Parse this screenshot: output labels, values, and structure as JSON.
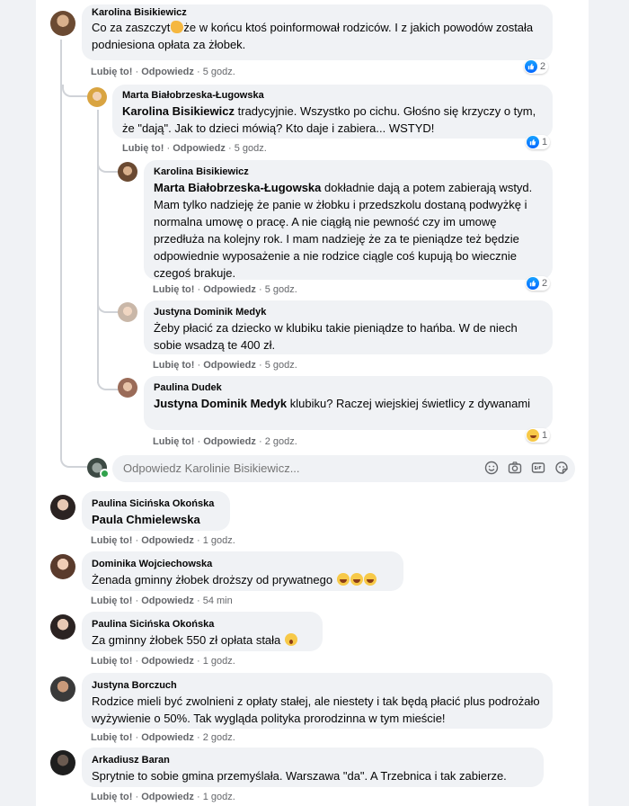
{
  "comment1": {
    "author": "Karolina Bisikiewicz",
    "text_a": "Co za zaszczyt",
    "text_b": "że w końcu ktoś poinformował rodziców. I z jakich powodów została podniesiona opłata za żłobek.",
    "like": "Lubię to!",
    "reply": "Odpowiedz",
    "time": "5 godz.",
    "reaction_count": "2"
  },
  "reply1": {
    "author": "Marta Białobrzeska-Ługowska",
    "mention": "Karolina Bisikiewicz",
    "text": "tradycyjnie. Wszystko po cichu. Głośno się krzyczy o tym, że \"dają\". Jak to dzieci mówią? Kto daje i zabiera... WSTYD!",
    "like": "Lubię to!",
    "reply": "Odpowiedz",
    "time": "5 godz.",
    "reaction_count": "1"
  },
  "reply2": {
    "author": "Karolina Bisikiewicz",
    "mention": "Marta Białobrzeska-Ługowska",
    "text": "dokładnie dają a potem zabierają wstyd. Mam tylko nadzieję że panie w żłobku i przedszkolu dostaną podwyżkę i normalna umowę o pracę. A nie ciągłą nie pewność czy im umowę przedłuża na kolejny rok. I mam nadzieję że za te pieniądze też będzie odpowiednie wyposażenie a nie rodzice ciągle coś kupują bo wiecznie czegoś brakuje.",
    "like": "Lubię to!",
    "reply": "Odpowiedz",
    "time": "5 godz.",
    "reaction_count": "2"
  },
  "reply3": {
    "author": "Justyna Dominik Medyk",
    "text": "Żeby płacić za dziecko w klubiku takie pieniądze to hańba. W de niech sobie wsadzą te 400 zł.",
    "like": "Lubię to!",
    "reply": "Odpowiedz",
    "time": "5 godz."
  },
  "reply4": {
    "author": "Paulina Dudek",
    "mention": "Justyna Dominik Medyk",
    "text": "klubiku? Raczej wiejskiej świetlicy z dywanami",
    "like": "Lubię to!",
    "reply": "Odpowiedz",
    "time": "2 godz.",
    "reaction_count": "1"
  },
  "reply_box": {
    "placeholder": "Odpowiedz Karolinie Bisikiewicz..."
  },
  "comment2": {
    "author": "Paulina Sicińska Okońska",
    "mention": "Paula Chmielewska",
    "like": "Lubię to!",
    "reply": "Odpowiedz",
    "time": "1 godz."
  },
  "comment3": {
    "author": "Dominika Wojciechowska",
    "text": "Żenada gminny żłobek droższy od prywatnego",
    "like": "Lubię to!",
    "reply": "Odpowiedz",
    "time": "54 min"
  },
  "comment4": {
    "author": "Paulina Sicińska Okońska",
    "text": "Za gminny żłobek 550 zł opłata stała",
    "like": "Lubię to!",
    "reply": "Odpowiedz",
    "time": "1 godz."
  },
  "comment5": {
    "author": "Justyna Borczuch",
    "text": "Rodzice mieli być zwolnieni z opłaty stałej, ale niestety i tak będą płacić plus podrożało wyżywienie o 50%. Tak wygląda polityka prorodzinna w tym mieście!",
    "like": "Lubię to!",
    "reply": "Odpowiedz",
    "time": "2 godz."
  },
  "comment6": {
    "author": "Arkadiusz Baran",
    "text": "Sprytnie to sobie gmina przemyślała. Warszawa \"da\". A Trzebnica i tak zabierze.",
    "like": "Lubię to!",
    "reply": "Odpowiedz",
    "time": "1 godz."
  },
  "separator": "·",
  "colors": {
    "like_blue": "#1877f2",
    "bubble_bg": "#f0f2f5",
    "meta_gray": "#65676b",
    "online_green": "#31a24c"
  },
  "icons": [
    "like-icon",
    "haha-icon",
    "emoji-icon",
    "camera-icon",
    "gif-icon",
    "sticker-icon"
  ]
}
